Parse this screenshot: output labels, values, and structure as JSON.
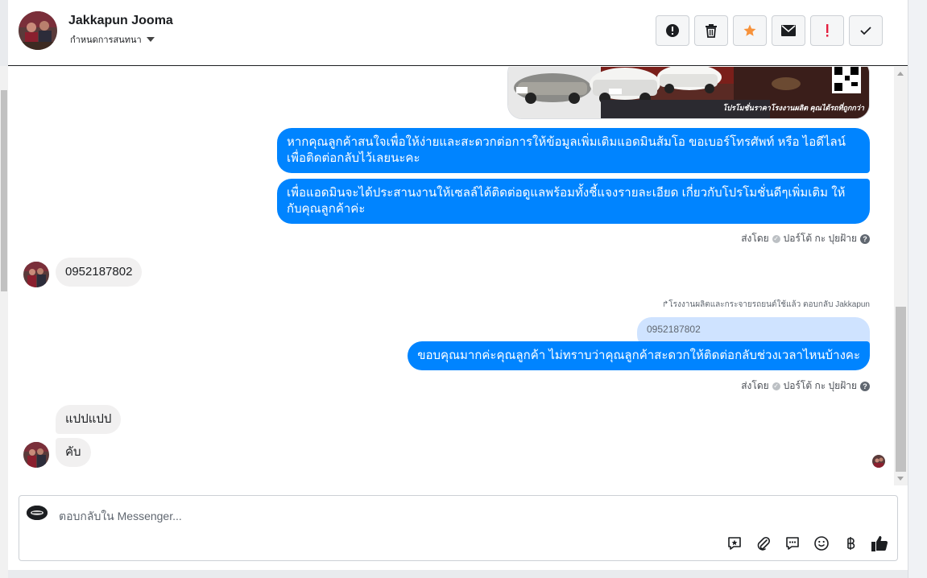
{
  "header": {
    "contact_name": "Jakkapun Jooma",
    "assign_label": "กำหนดการสนทนา",
    "actions": [
      {
        "name": "report-icon",
        "glyph": "!"
      },
      {
        "name": "trash-icon",
        "glyph": ""
      },
      {
        "name": "star-icon",
        "glyph": "★"
      },
      {
        "name": "envelope-icon",
        "glyph": ""
      },
      {
        "name": "follow-up-icon",
        "glyph": "!"
      },
      {
        "name": "check-icon",
        "glyph": "✓"
      }
    ]
  },
  "image_card": {
    "caption": "โปรโมชั่นราคาโรงงานผลิต คุณได้รถที่ถูกกว่า"
  },
  "messages": {
    "out_1": "หากคุณลูกค้าสนใจเพื่อให้ง่ายและสะดวกต่อการให้ข้อมูลเพิ่มเติมแอดมินส้มโอ ขอเบอร์โทรศัพท์ หรือ ไอดีไลน์ เพื่อติดต่อกลับไว้เลยนะคะ",
    "out_2": "เพื่อแอดมินจะได้ประสานงานให้เซลล์ได้ติดต่อดูแลพร้อมทั้งชี้แจงรายละเอียด เกี่ยวกับโปรโมชั่นดีๆเพิ่มเติม ให้กับคุณลูกค้าค่ะ",
    "sent_by_1": "ส่งโดย",
    "sender_1": "ปอร์โต้ กะ ปุยฝ้าย",
    "in_1": "0952187802",
    "reply_meta": "โรงงานผลิตและกระจายรถยนต์ใช้แล้ว ตอบกลับ Jakkapun",
    "quoted_text": "0952187802",
    "out_3": "ขอบคุณมากค่ะคุณลูกค้า ไม่ทราบว่าคุณลูกค้าสะดวกให้ติดต่อกลับช่วงเวลาไหนบ้างคะ",
    "sent_by_2": "ส่งโดย",
    "sender_2": "ปอร์โต้ กะ ปุยฝ้าย",
    "in_2": "แปปแปป",
    "in_3": "คับ"
  },
  "composer": {
    "placeholder": "ตอบกลับใน Messenger..."
  },
  "colors": {
    "outgoing_bubble": "#0084ff",
    "incoming_bubble": "#f1f0f0",
    "star": "#f7923b",
    "alert": "#e41e3f"
  }
}
